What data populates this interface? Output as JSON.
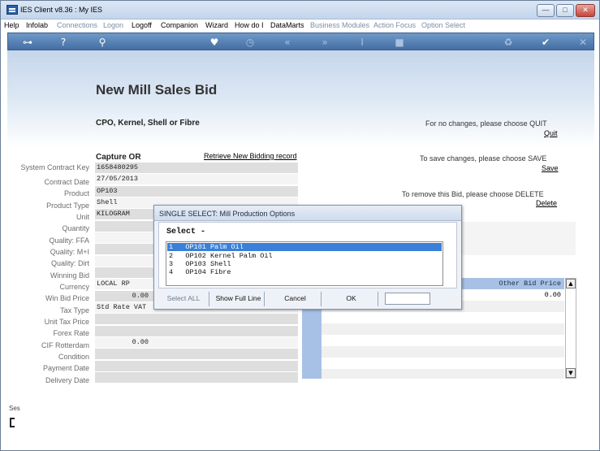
{
  "window": {
    "title": "IES Client v8.36 : My IES",
    "buttons": {
      "minimize": "—",
      "maximize": "□",
      "close": "✕"
    }
  },
  "menu": {
    "items": [
      {
        "label": "Help",
        "dim": false
      },
      {
        "label": "Infolab",
        "dim": false
      },
      {
        "label": "Connections",
        "dim": true
      },
      {
        "label": "Logon",
        "dim": true
      },
      {
        "label": "Logoff",
        "dim": false
      },
      {
        "label": "Companion",
        "dim": false
      },
      {
        "label": "Wizard",
        "dim": false
      },
      {
        "label": "How do I",
        "dim": false
      },
      {
        "label": "DataMarts",
        "dim": false
      },
      {
        "label": "Business Modules",
        "dim": true
      },
      {
        "label": "Action Focus",
        "dim": true
      },
      {
        "label": "Option Select",
        "dim": true
      }
    ]
  },
  "toolbar": {
    "icons": [
      "key-icon",
      "help-icon",
      "search-icon",
      "heart-icon",
      "clock-icon",
      "back-icon",
      "forward-icon",
      "text-cursor-icon",
      "stop-icon",
      "recycle-icon",
      "check-icon",
      "close-icon"
    ]
  },
  "page": {
    "title": "New Mill Sales Bid",
    "subtitle": "CPO, Kernel, Shell or Fibre",
    "capture_label": "Capture OR",
    "retrieve_link": "Retrieve New Bidding record",
    "quit_hint": "For no changes, please choose QUIT",
    "quit_link": "Quit",
    "save_hint": "To save changes, please choose SAVE",
    "save_link": "Save",
    "delete_hint": "To remove this Bid,  please choose  DELETE",
    "delete_link": "Delete"
  },
  "fields": [
    {
      "label": "System Contract Key",
      "value": "1658480295"
    },
    {
      "label": "Contract Date",
      "value": "27/05/2013"
    },
    {
      "label": "Product",
      "value": "OP103"
    },
    {
      "label": "Product Type",
      "value": "Shell"
    },
    {
      "label": "Unit",
      "value": "KILOGRAM"
    },
    {
      "label": "Quantity",
      "value": ""
    },
    {
      "label": "Quality: FFA",
      "value": ""
    },
    {
      "label": "Quality: M+I",
      "value": ""
    },
    {
      "label": "Quality: Dirt",
      "value": ""
    },
    {
      "label": "Winning Bid",
      "value": ""
    },
    {
      "label": "Currency",
      "value": "LOCAL RP"
    },
    {
      "label": "Win Bid Price",
      "value": "0.00"
    },
    {
      "label": "Tax Type",
      "value": "Std Rate VAT"
    },
    {
      "label": "Unit Tax Price",
      "value": ""
    },
    {
      "label": "Forex Rate",
      "value": ""
    },
    {
      "label": "CIF Rotterdam",
      "value": "0.00"
    },
    {
      "label": "Condition",
      "value": ""
    },
    {
      "label": "Payment Date",
      "value": ""
    },
    {
      "label": "Delivery Date",
      "value": ""
    }
  ],
  "grid": {
    "header": "Other Bid Price",
    "first_value": "0.00",
    "scroll_up": "▲",
    "scroll_down": "▼"
  },
  "statusbar": {
    "text": "Ses"
  },
  "dialog": {
    "title": "SINGLE SELECT: Mill Production Options",
    "prompt": "Select -",
    "options": [
      "1   OP101 Palm Oil",
      "2   OP102 Kernel Palm Oil",
      "3   OP103 Shell",
      "4   OP104 Fibre"
    ],
    "selected_index": 0,
    "buttons": {
      "select_all": "Select ALL",
      "show_full_line": "Show Full Line",
      "cancel": "Cancel",
      "ok": "OK"
    }
  }
}
